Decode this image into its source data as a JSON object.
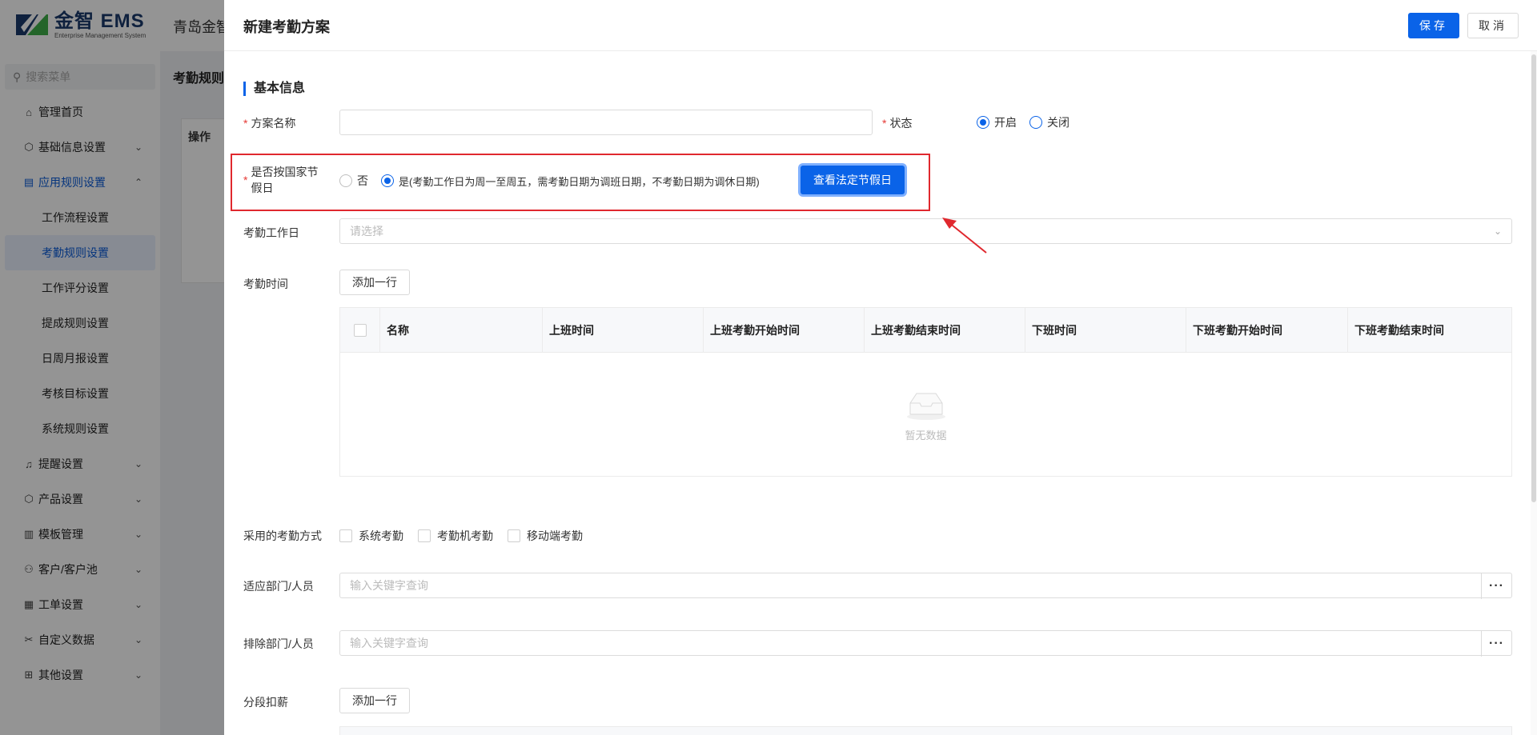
{
  "app": {
    "logo_text": "金智 EMS",
    "logo_subtitle": "Enterprise Management System",
    "company_name": "青岛金智",
    "search_placeholder": "搜索菜单",
    "page_title": "考勤规则",
    "table_op_label": "操作"
  },
  "sidebar": {
    "items": [
      {
        "label": "管理首页",
        "icon": "home-icon"
      },
      {
        "label": "基础信息设置",
        "icon": "cube-icon"
      },
      {
        "label": "应用规则设置",
        "icon": "document-icon"
      },
      {
        "label": "提醒设置",
        "icon": "bell-icon"
      },
      {
        "label": "产品设置",
        "icon": "cube-icon"
      },
      {
        "label": "模板管理",
        "icon": "template-icon"
      },
      {
        "label": "客户/客户池",
        "icon": "users-icon"
      },
      {
        "label": "工单设置",
        "icon": "ticket-icon"
      },
      {
        "label": "自定义数据",
        "icon": "tools-icon"
      },
      {
        "label": "其他设置",
        "icon": "grid-icon"
      }
    ],
    "sub_items": [
      "工作流程设置",
      "考勤规则设置",
      "工作评分设置",
      "提成规则设置",
      "日周月报设置",
      "考核目标设置",
      "系统规则设置"
    ],
    "active_sub": "考勤规则设置"
  },
  "drawer": {
    "title": "新建考勤方案",
    "save_label": "保存",
    "cancel_label": "取消",
    "section_basic": "基本信息",
    "plan_name_label": "方案名称",
    "status_label": "状态",
    "status_on": "开启",
    "status_off": "关闭",
    "holiday_label": "是否按国家节假日",
    "holiday_no": "否",
    "holiday_yes": "是(考勤工作日为周一至周五，需考勤日期为调班日期，不考勤日期为调休日期)",
    "holiday_button": "查看法定节假日",
    "workday_label": "考勤工作日",
    "workday_placeholder": "请选择",
    "time_label": "考勤时间",
    "add_row_label": "添加一行",
    "table_columns": [
      "名称",
      "上班时间",
      "上班考勤开始时间",
      "上班考勤结束时间",
      "下班时间",
      "下班考勤开始时间",
      "下班考勤结束时间"
    ],
    "empty_text": "暂无数据",
    "method_label": "采用的考勤方式",
    "methods": [
      "系统考勤",
      "考勤机考勤",
      "移动端考勤"
    ],
    "dept_label": "适应部门/人员",
    "dept_placeholder": "输入关键字查询",
    "exclude_label": "排除部门/人员",
    "exclude_placeholder": "输入关键字查询",
    "salary_label": "分段扣薪",
    "salary_add_label": "添加一行",
    "dots": "···"
  },
  "colors": {
    "primary": "#0a63e8",
    "highlight": "#e0282e",
    "mask": "rgba(0,0,0,0.42)"
  }
}
